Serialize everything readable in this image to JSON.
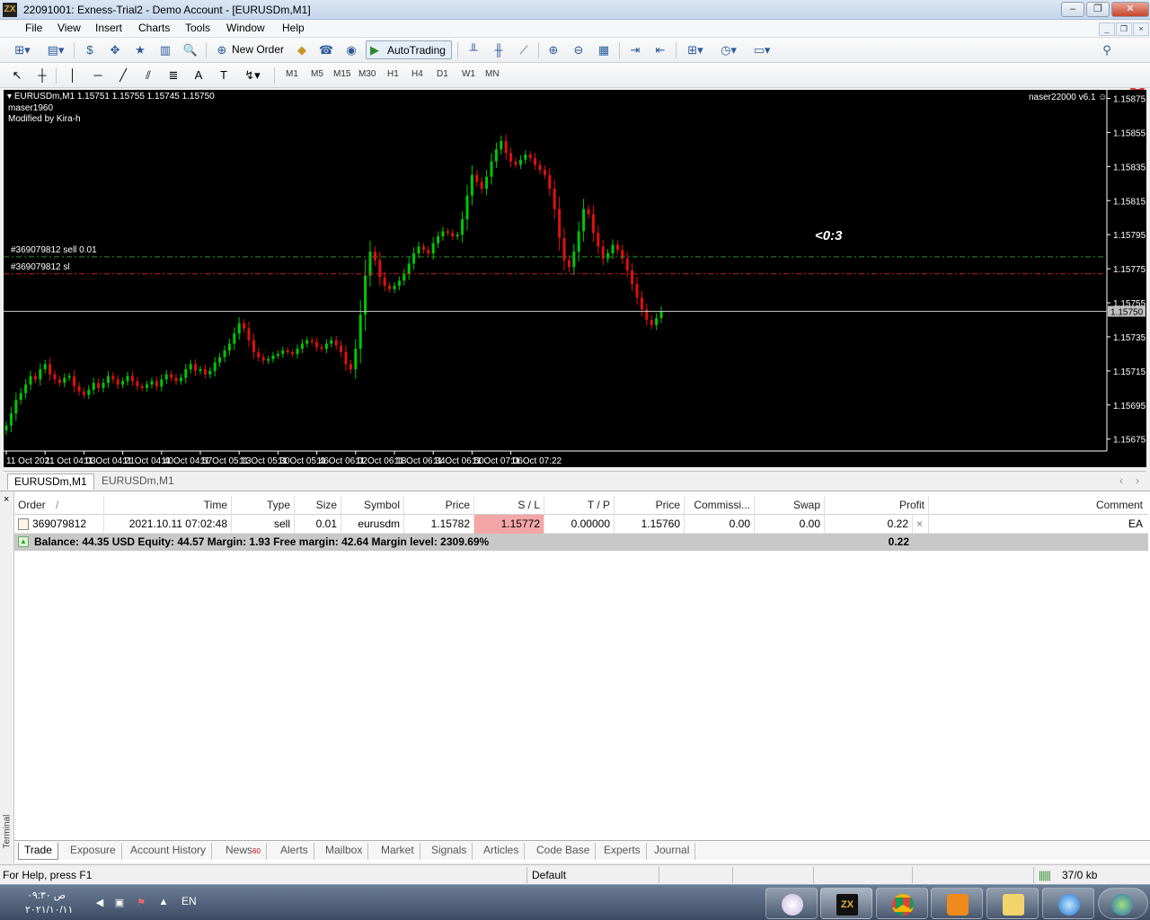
{
  "window": {
    "title": "22091001: Exness-Trial2 - Demo Account - [EURUSDm,M1]",
    "logo": "ZX"
  },
  "menu": [
    "File",
    "View",
    "Insert",
    "Charts",
    "Tools",
    "Window",
    "Help"
  ],
  "toolbar": {
    "new_order": "New Order",
    "autotrading": "AutoTrading",
    "alert_count": "1"
  },
  "timeframes": [
    "M1",
    "M5",
    "M15",
    "M30",
    "H1",
    "H4",
    "D1",
    "W1",
    "MN"
  ],
  "chart": {
    "header": "EURUSDm,M1  1.15751 1.15755 1.15745 1.15750",
    "indicator_line1": "maser1960",
    "indicator_line2": "Modified by Kira-h",
    "ea_name": "naser22000  v6.1",
    "countdown": "<0:3",
    "order_label": "#369079812 sell 0.01",
    "sl_label": "#369079812 sl",
    "bid": "1.15750",
    "colors": {
      "bull": "#00c800",
      "bear": "#e01010",
      "order_line": "#2e8b2e",
      "sl_line": "#c81e1e",
      "countdown": "#27d327"
    }
  },
  "chart_data": {
    "type": "candlestick",
    "symbol": "EURUSDm",
    "timeframe": "M1",
    "price_axis": [
      "1.15875",
      "1.15855",
      "1.15835",
      "1.15815",
      "1.15795",
      "1.15775",
      "1.15755",
      "1.15735",
      "1.15715",
      "1.15695",
      "1.15675"
    ],
    "price_range": [
      1.15668,
      1.1588
    ],
    "time_axis": [
      "11 Oct 2021",
      "11 Oct 04:03",
      "11 Oct 04:21",
      "11 Oct 04:40",
      "11 Oct 04:57",
      "11 Oct 05:13",
      "11 Oct 05:30",
      "11 Oct 05:46",
      "11 Oct 06:02",
      "11 Oct 06:18",
      "11 Oct 06:34",
      "11 Oct 06:50",
      "11 Oct 07:06",
      "11 Oct 07:22"
    ],
    "order_price": 1.15782,
    "sl_price": 1.15772,
    "bid_price": 1.1575,
    "candles_per_label": 8,
    "closes": [
      1.15683,
      1.1569,
      1.15698,
      1.15702,
      1.15707,
      1.15712,
      1.1571,
      1.15716,
      1.15719,
      1.15713,
      1.1571,
      1.15708,
      1.15711,
      1.15712,
      1.15706,
      1.15703,
      1.15701,
      1.15704,
      1.15708,
      1.15705,
      1.15708,
      1.15712,
      1.1571,
      1.15707,
      1.15709,
      1.15712,
      1.15709,
      1.15706,
      1.15705,
      1.15707,
      1.15709,
      1.15706,
      1.1571,
      1.15713,
      1.15711,
      1.15709,
      1.15711,
      1.15716,
      1.15719,
      1.15715,
      1.15716,
      1.15713,
      1.15715,
      1.1572,
      1.15723,
      1.15727,
      1.15731,
      1.15737,
      1.15743,
      1.1574,
      1.15733,
      1.15726,
      1.15723,
      1.15721,
      1.15722,
      1.15724,
      1.15725,
      1.15727,
      1.15726,
      1.15725,
      1.15728,
      1.15731,
      1.15733,
      1.15732,
      1.15729,
      1.15728,
      1.15731,
      1.15733,
      1.1573,
      1.15726,
      1.15719,
      1.15716,
      1.15728,
      1.15748,
      1.15771,
      1.15785,
      1.1578,
      1.1577,
      1.15765,
      1.15763,
      1.15765,
      1.15768,
      1.15772,
      1.15778,
      1.15784,
      1.15788,
      1.15786,
      1.15784,
      1.1579,
      1.15794,
      1.15797,
      1.15796,
      1.15794,
      1.15795,
      1.15804,
      1.15818,
      1.1583,
      1.15826,
      1.15822,
      1.15829,
      1.15838,
      1.15845,
      1.1585,
      1.15843,
      1.15838,
      1.15836,
      1.15839,
      1.15842,
      1.1584,
      1.15836,
      1.15833,
      1.1583,
      1.15822,
      1.1581,
      1.15793,
      1.1578,
      1.15776,
      1.15785,
      1.15797,
      1.1581,
      1.15807,
      1.15796,
      1.15788,
      1.15781,
      1.15784,
      1.15789,
      1.15786,
      1.15781,
      1.15774,
      1.15766,
      1.15758,
      1.15751,
      1.15745,
      1.15742,
      1.15746,
      1.1575
    ]
  },
  "chart_tabs": [
    "EURUSDm,M1",
    "EURUSDm,M1"
  ],
  "terminal": {
    "columns": [
      "Order",
      "/",
      "Time",
      "Type",
      "Size",
      "Symbol",
      "Price",
      "S / L",
      "T / P",
      "Price",
      "Commissi...",
      "Swap",
      "Profit",
      "Comment"
    ],
    "order": {
      "id": "369079812",
      "time": "2021.10.11 07:02:48",
      "type": "sell",
      "size": "0.01",
      "symbol": "eurusdm",
      "open_price": "1.15782",
      "sl": "1.15772",
      "tp": "0.00000",
      "price": "1.15760",
      "commission": "0.00",
      "swap": "0.00",
      "profit": "0.22",
      "comment": "EA"
    },
    "balance_line": "Balance: 44.35 USD  Equity: 44.57  Margin: 1.93  Free margin: 42.64  Margin level: 2309.69%",
    "total_profit": "0.22",
    "side_label": "Terminal",
    "close": "×"
  },
  "bottom_tabs": [
    "Trade",
    "Exposure",
    "Account History",
    "News",
    "Alerts",
    "Mailbox",
    "Market",
    "Signals",
    "Articles",
    "Code Base",
    "Experts",
    "Journal"
  ],
  "news_count": "60",
  "status": {
    "help": "For Help, press F1",
    "profile": "Default",
    "traffic": "37/0 kb"
  },
  "tray": {
    "time": "۰۹:۳۰ ص",
    "date": "۲۰۲۱/۱۰/۱۱",
    "lang": "EN"
  }
}
